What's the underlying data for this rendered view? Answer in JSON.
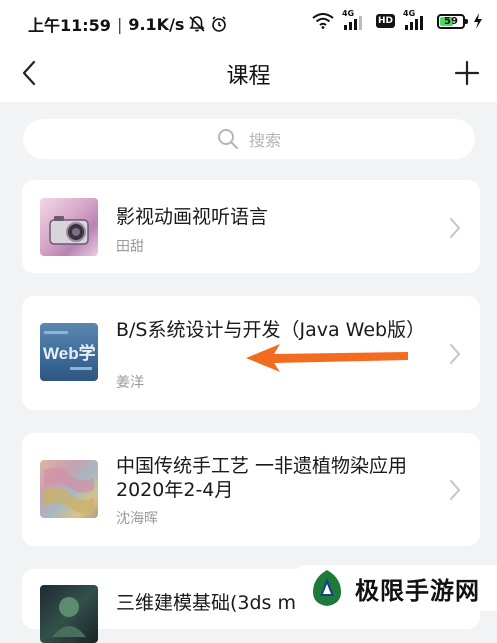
{
  "status_bar": {
    "time": "上午11:59",
    "net_speed": "9.1K/s",
    "net_tag_1": "4G",
    "hd_label": "HD",
    "net_tag_2": "4G",
    "battery": "59",
    "battery_level": 0.59
  },
  "nav": {
    "title": "课程"
  },
  "search": {
    "placeholder": "搜索"
  },
  "courses": [
    {
      "title": "影视动画视听语言",
      "teacher": "田甜",
      "thumb_icon": "camera-thumbnail"
    },
    {
      "title": "B/S系统设计与开发（Java Web版）",
      "teacher": "姜洋",
      "thumb_icon": "web-thumbnail",
      "thumb_text": "Web学"
    },
    {
      "title": "中国传统手工艺 一非遗植物染应用2020年2-4月",
      "teacher": "沈海晖",
      "thumb_icon": "dyed-fabric-thumbnail"
    },
    {
      "title": "三维建模基础(3ds m",
      "teacher": "",
      "thumb_icon": "3d-model-thumbnail"
    }
  ],
  "annotation": {
    "arrow_color": "#f26b21"
  },
  "watermark": {
    "text": "极限手游网"
  },
  "colors": {
    "accent": "#f26b21",
    "battery": "#4cd964",
    "page_bg": "#f2f3f5"
  }
}
